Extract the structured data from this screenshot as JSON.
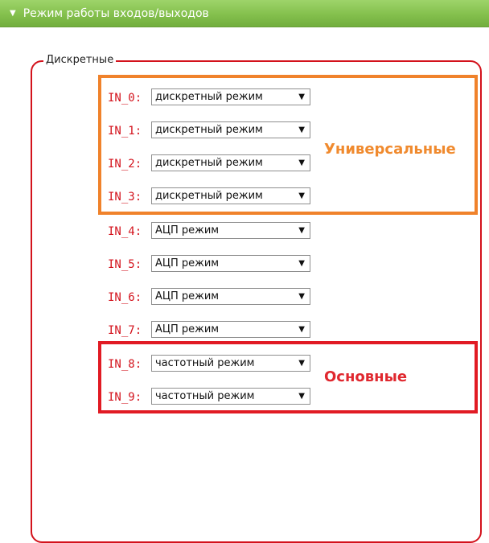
{
  "header": {
    "title": "Режим работы входов/выходов",
    "collapse_icon": "triangle-down"
  },
  "fieldset": {
    "legend": "Дискретные"
  },
  "inputs": [
    {
      "label": "IN_0:",
      "value": "дискретный режим"
    },
    {
      "label": "IN_1:",
      "value": "дискретный режим"
    },
    {
      "label": "IN_2:",
      "value": "дискретный режим"
    },
    {
      "label": "IN_3:",
      "value": "дискретный режим"
    },
    {
      "label": "IN_4:",
      "value": "АЦП режим"
    },
    {
      "label": "IN_5:",
      "value": "АЦП режим"
    },
    {
      "label": "IN_6:",
      "value": "АЦП режим"
    },
    {
      "label": "IN_7:",
      "value": "АЦП режим"
    },
    {
      "label": "IN_8:",
      "value": "частотный режим"
    },
    {
      "label": "IN_9:",
      "value": "частотный режим"
    }
  ],
  "annotations": {
    "universal": "Универсальные",
    "basic": "Основные"
  },
  "colors": {
    "header_green": "#84c04d",
    "fieldset_red": "#d3121c",
    "annotation_orange": "#f0822b",
    "annotation_red": "#e11b24"
  }
}
